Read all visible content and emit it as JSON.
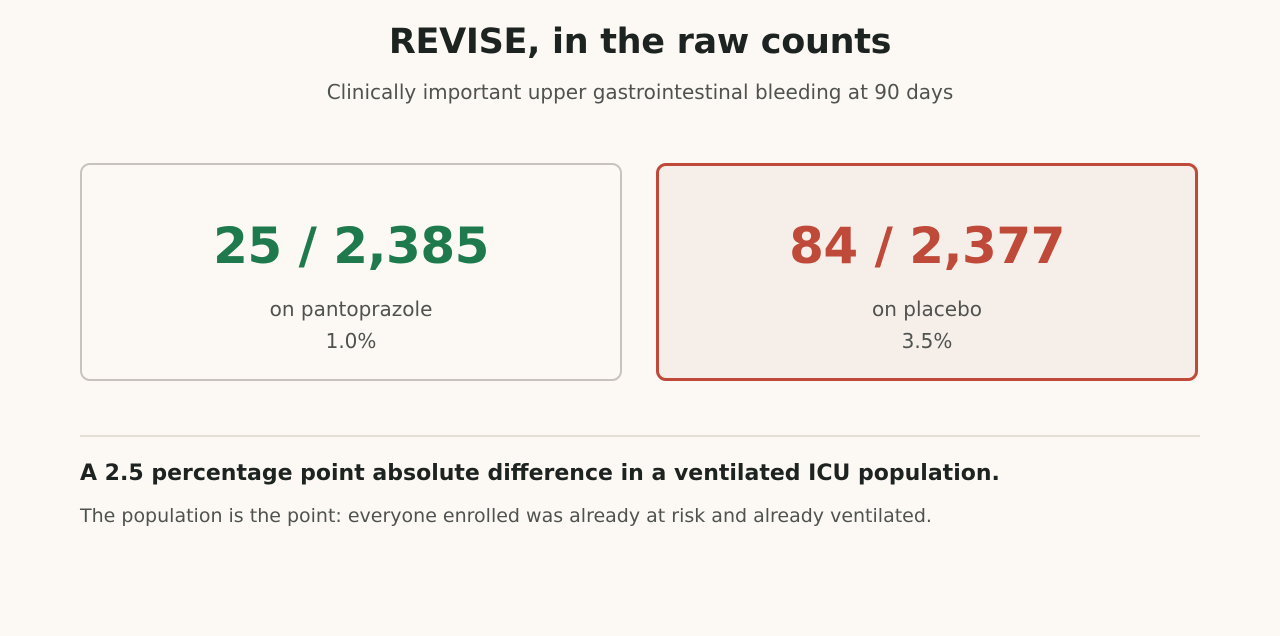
{
  "header": {
    "title": "REVISE, in the raw counts",
    "subtitle": "Clinically important upper gastrointestinal bleeding at 90 days"
  },
  "cards": [
    {
      "count": "25 / 2,385",
      "arm": "on pantoprazole",
      "percent": "1.0%",
      "accent_color": "#1e7a4c"
    },
    {
      "count": "84 / 2,377",
      "arm": "on placebo",
      "percent": "3.5%",
      "accent_color": "#bf4a39"
    }
  ],
  "summary": {
    "headline": "A 2.5 percentage point absolute difference in a ventilated ICU population.",
    "note": "The population is the point: everyone enrolled was already at risk and already ventilated."
  }
}
